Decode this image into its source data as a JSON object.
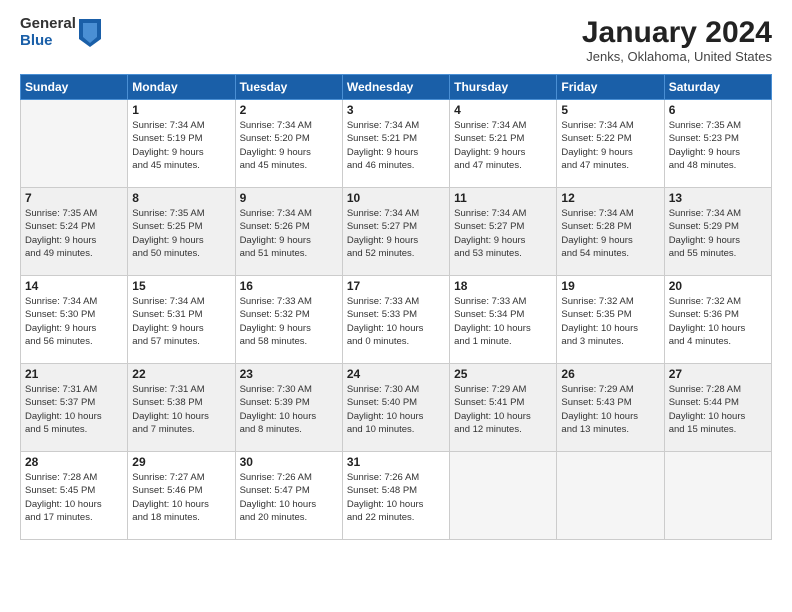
{
  "header": {
    "logo_general": "General",
    "logo_blue": "Blue",
    "month_title": "January 2024",
    "location": "Jenks, Oklahoma, United States"
  },
  "weekdays": [
    "Sunday",
    "Monday",
    "Tuesday",
    "Wednesday",
    "Thursday",
    "Friday",
    "Saturday"
  ],
  "weeks": [
    [
      {
        "day": "",
        "info": ""
      },
      {
        "day": "1",
        "info": "Sunrise: 7:34 AM\nSunset: 5:19 PM\nDaylight: 9 hours\nand 45 minutes."
      },
      {
        "day": "2",
        "info": "Sunrise: 7:34 AM\nSunset: 5:20 PM\nDaylight: 9 hours\nand 45 minutes."
      },
      {
        "day": "3",
        "info": "Sunrise: 7:34 AM\nSunset: 5:21 PM\nDaylight: 9 hours\nand 46 minutes."
      },
      {
        "day": "4",
        "info": "Sunrise: 7:34 AM\nSunset: 5:21 PM\nDaylight: 9 hours\nand 47 minutes."
      },
      {
        "day": "5",
        "info": "Sunrise: 7:34 AM\nSunset: 5:22 PM\nDaylight: 9 hours\nand 47 minutes."
      },
      {
        "day": "6",
        "info": "Sunrise: 7:35 AM\nSunset: 5:23 PM\nDaylight: 9 hours\nand 48 minutes."
      }
    ],
    [
      {
        "day": "7",
        "info": "Sunrise: 7:35 AM\nSunset: 5:24 PM\nDaylight: 9 hours\nand 49 minutes."
      },
      {
        "day": "8",
        "info": "Sunrise: 7:35 AM\nSunset: 5:25 PM\nDaylight: 9 hours\nand 50 minutes."
      },
      {
        "day": "9",
        "info": "Sunrise: 7:34 AM\nSunset: 5:26 PM\nDaylight: 9 hours\nand 51 minutes."
      },
      {
        "day": "10",
        "info": "Sunrise: 7:34 AM\nSunset: 5:27 PM\nDaylight: 9 hours\nand 52 minutes."
      },
      {
        "day": "11",
        "info": "Sunrise: 7:34 AM\nSunset: 5:27 PM\nDaylight: 9 hours\nand 53 minutes."
      },
      {
        "day": "12",
        "info": "Sunrise: 7:34 AM\nSunset: 5:28 PM\nDaylight: 9 hours\nand 54 minutes."
      },
      {
        "day": "13",
        "info": "Sunrise: 7:34 AM\nSunset: 5:29 PM\nDaylight: 9 hours\nand 55 minutes."
      }
    ],
    [
      {
        "day": "14",
        "info": "Sunrise: 7:34 AM\nSunset: 5:30 PM\nDaylight: 9 hours\nand 56 minutes."
      },
      {
        "day": "15",
        "info": "Sunrise: 7:34 AM\nSunset: 5:31 PM\nDaylight: 9 hours\nand 57 minutes."
      },
      {
        "day": "16",
        "info": "Sunrise: 7:33 AM\nSunset: 5:32 PM\nDaylight: 9 hours\nand 58 minutes."
      },
      {
        "day": "17",
        "info": "Sunrise: 7:33 AM\nSunset: 5:33 PM\nDaylight: 10 hours\nand 0 minutes."
      },
      {
        "day": "18",
        "info": "Sunrise: 7:33 AM\nSunset: 5:34 PM\nDaylight: 10 hours\nand 1 minute."
      },
      {
        "day": "19",
        "info": "Sunrise: 7:32 AM\nSunset: 5:35 PM\nDaylight: 10 hours\nand 3 minutes."
      },
      {
        "day": "20",
        "info": "Sunrise: 7:32 AM\nSunset: 5:36 PM\nDaylight: 10 hours\nand 4 minutes."
      }
    ],
    [
      {
        "day": "21",
        "info": "Sunrise: 7:31 AM\nSunset: 5:37 PM\nDaylight: 10 hours\nand 5 minutes."
      },
      {
        "day": "22",
        "info": "Sunrise: 7:31 AM\nSunset: 5:38 PM\nDaylight: 10 hours\nand 7 minutes."
      },
      {
        "day": "23",
        "info": "Sunrise: 7:30 AM\nSunset: 5:39 PM\nDaylight: 10 hours\nand 8 minutes."
      },
      {
        "day": "24",
        "info": "Sunrise: 7:30 AM\nSunset: 5:40 PM\nDaylight: 10 hours\nand 10 minutes."
      },
      {
        "day": "25",
        "info": "Sunrise: 7:29 AM\nSunset: 5:41 PM\nDaylight: 10 hours\nand 12 minutes."
      },
      {
        "day": "26",
        "info": "Sunrise: 7:29 AM\nSunset: 5:43 PM\nDaylight: 10 hours\nand 13 minutes."
      },
      {
        "day": "27",
        "info": "Sunrise: 7:28 AM\nSunset: 5:44 PM\nDaylight: 10 hours\nand 15 minutes."
      }
    ],
    [
      {
        "day": "28",
        "info": "Sunrise: 7:28 AM\nSunset: 5:45 PM\nDaylight: 10 hours\nand 17 minutes."
      },
      {
        "day": "29",
        "info": "Sunrise: 7:27 AM\nSunset: 5:46 PM\nDaylight: 10 hours\nand 18 minutes."
      },
      {
        "day": "30",
        "info": "Sunrise: 7:26 AM\nSunset: 5:47 PM\nDaylight: 10 hours\nand 20 minutes."
      },
      {
        "day": "31",
        "info": "Sunrise: 7:26 AM\nSunset: 5:48 PM\nDaylight: 10 hours\nand 22 minutes."
      },
      {
        "day": "",
        "info": ""
      },
      {
        "day": "",
        "info": ""
      },
      {
        "day": "",
        "info": ""
      }
    ]
  ]
}
